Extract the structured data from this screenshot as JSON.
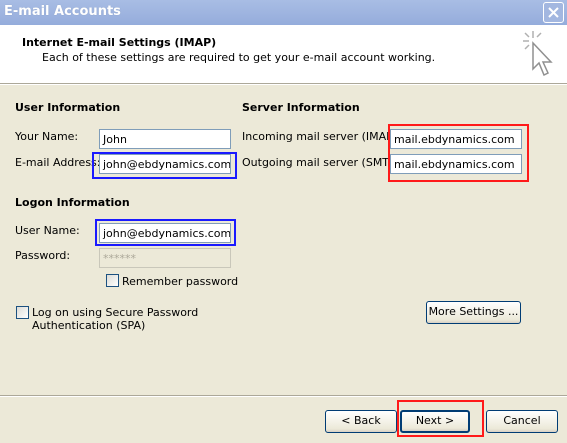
{
  "window": {
    "title": "E-mail Accounts",
    "close_icon": "close-icon"
  },
  "header": {
    "title": "Internet E-mail Settings (IMAP)",
    "subtitle": "Each of these settings are required to get your e-mail account working.",
    "icon": "wizard-cursor-icon"
  },
  "user_info": {
    "section_title": "User Information",
    "name_label": "Your Name:",
    "name_value": "John",
    "email_label": "E-mail Address:",
    "email_value": "john@ebdynamics.com"
  },
  "server_info": {
    "section_title": "Server Information",
    "incoming_label": "Incoming mail server (IMAP):",
    "incoming_value": "mail.ebdynamics.com",
    "outgoing_label": "Outgoing mail server (SMTP):",
    "outgoing_value": "mail.ebdynamics.com"
  },
  "logon_info": {
    "section_title": "Logon Information",
    "username_label": "User Name:",
    "username_value": "john@ebdynamics.com",
    "password_label": "Password:",
    "password_value": "******",
    "remember_label": "Remember password",
    "remember_checked": false
  },
  "spa": {
    "label_line1": "Log on using Secure Password",
    "label_line2": "Authentication (SPA)",
    "checked": false
  },
  "buttons": {
    "more_settings": "More Settings ...",
    "back": "< Back",
    "next": "Next >",
    "cancel": "Cancel"
  },
  "colors": {
    "highlight_blue": "#1a1aff",
    "highlight_red": "#ff1a1a",
    "titlebar": "#9db3df",
    "dialog_bg": "#ece9d8"
  }
}
